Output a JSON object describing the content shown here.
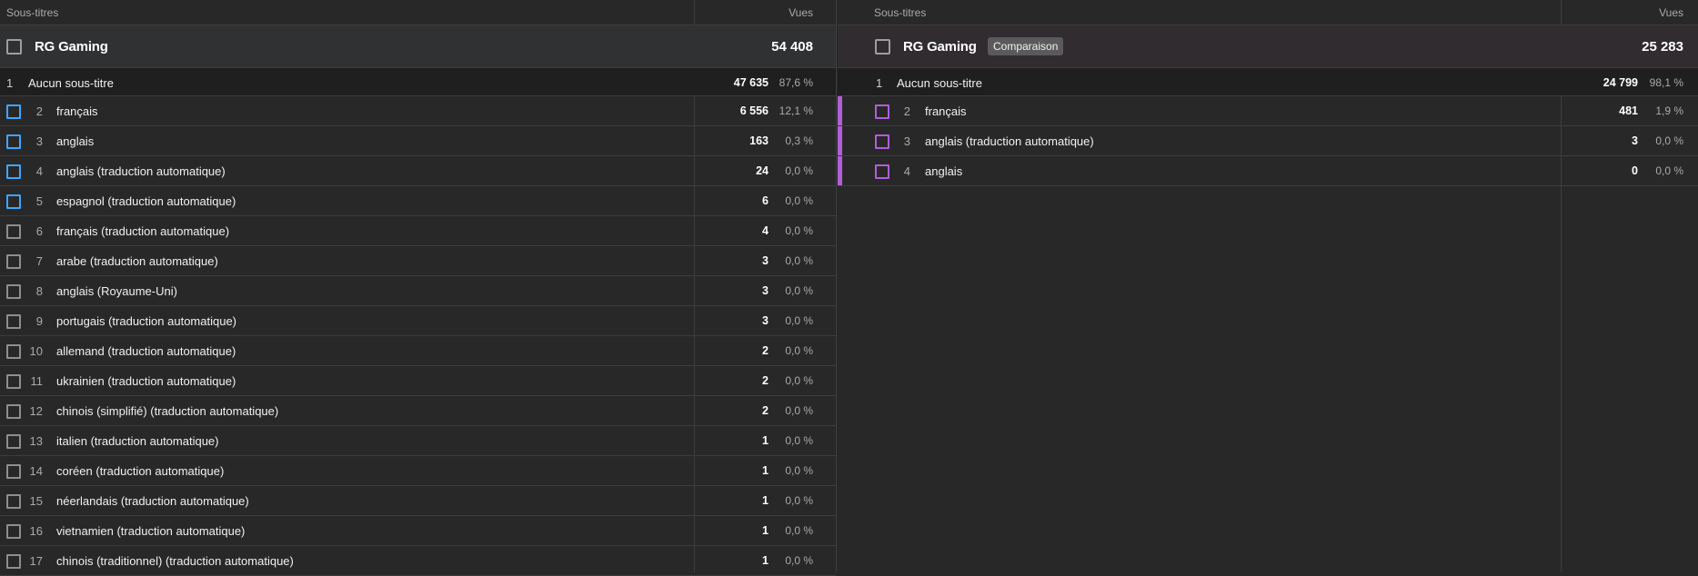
{
  "colors": {
    "blue_check": "#3ea6ff",
    "purple_check": "#b05fd8",
    "accent_bar": "#b05fd8"
  },
  "left": {
    "header": {
      "label": "Sous-titres",
      "metric": "Vues"
    },
    "group": {
      "name": "RG Gaming",
      "total": "54 408"
    },
    "none_row": {
      "index": "1",
      "label": "Aucun sous-titre",
      "value": "47 635",
      "pct": "87,6 %"
    },
    "rows": [
      {
        "index": "2",
        "label": "français",
        "value": "6 556",
        "pct": "12,1 %",
        "check": "blue"
      },
      {
        "index": "3",
        "label": "anglais",
        "value": "163",
        "pct": "0,3 %",
        "check": "blue"
      },
      {
        "index": "4",
        "label": "anglais (traduction automatique)",
        "value": "24",
        "pct": "0,0 %",
        "check": "blue"
      },
      {
        "index": "5",
        "label": "espagnol (traduction automatique)",
        "value": "6",
        "pct": "0,0 %",
        "check": "blue"
      },
      {
        "index": "6",
        "label": "français (traduction automatique)",
        "value": "4",
        "pct": "0,0 %",
        "check": "gray"
      },
      {
        "index": "7",
        "label": "arabe (traduction automatique)",
        "value": "3",
        "pct": "0,0 %",
        "check": "gray"
      },
      {
        "index": "8",
        "label": "anglais (Royaume-Uni)",
        "value": "3",
        "pct": "0,0 %",
        "check": "gray"
      },
      {
        "index": "9",
        "label": "portugais (traduction automatique)",
        "value": "3",
        "pct": "0,0 %",
        "check": "gray"
      },
      {
        "index": "10",
        "label": "allemand (traduction automatique)",
        "value": "2",
        "pct": "0,0 %",
        "check": "gray"
      },
      {
        "index": "11",
        "label": "ukrainien (traduction automatique)",
        "value": "2",
        "pct": "0,0 %",
        "check": "gray"
      },
      {
        "index": "12",
        "label": "chinois (simplifié) (traduction automatique)",
        "value": "2",
        "pct": "0,0 %",
        "check": "gray"
      },
      {
        "index": "13",
        "label": "italien (traduction automatique)",
        "value": "1",
        "pct": "0,0 %",
        "check": "gray"
      },
      {
        "index": "14",
        "label": "coréen (traduction automatique)",
        "value": "1",
        "pct": "0,0 %",
        "check": "gray"
      },
      {
        "index": "15",
        "label": "néerlandais (traduction automatique)",
        "value": "1",
        "pct": "0,0 %",
        "check": "gray"
      },
      {
        "index": "16",
        "label": "vietnamien (traduction automatique)",
        "value": "1",
        "pct": "0,0 %",
        "check": "gray"
      },
      {
        "index": "17",
        "label": "chinois (traditionnel) (traduction automatique)",
        "value": "1",
        "pct": "0,0 %",
        "check": "gray"
      }
    ]
  },
  "right": {
    "header": {
      "label": "Sous-titres",
      "metric": "Vues"
    },
    "group": {
      "name": "RG Gaming",
      "badge": "Comparaison",
      "total": "25 283"
    },
    "none_row": {
      "index": "1",
      "label": "Aucun sous-titre",
      "value": "24 799",
      "pct": "98,1 %"
    },
    "rows": [
      {
        "index": "2",
        "label": "français",
        "value": "481",
        "pct": "1,9 %",
        "check": "purple"
      },
      {
        "index": "3",
        "label": "anglais (traduction automatique)",
        "value": "3",
        "pct": "0,0 %",
        "check": "purple"
      },
      {
        "index": "4",
        "label": "anglais",
        "value": "0",
        "pct": "0,0 %",
        "check": "purple"
      }
    ]
  }
}
